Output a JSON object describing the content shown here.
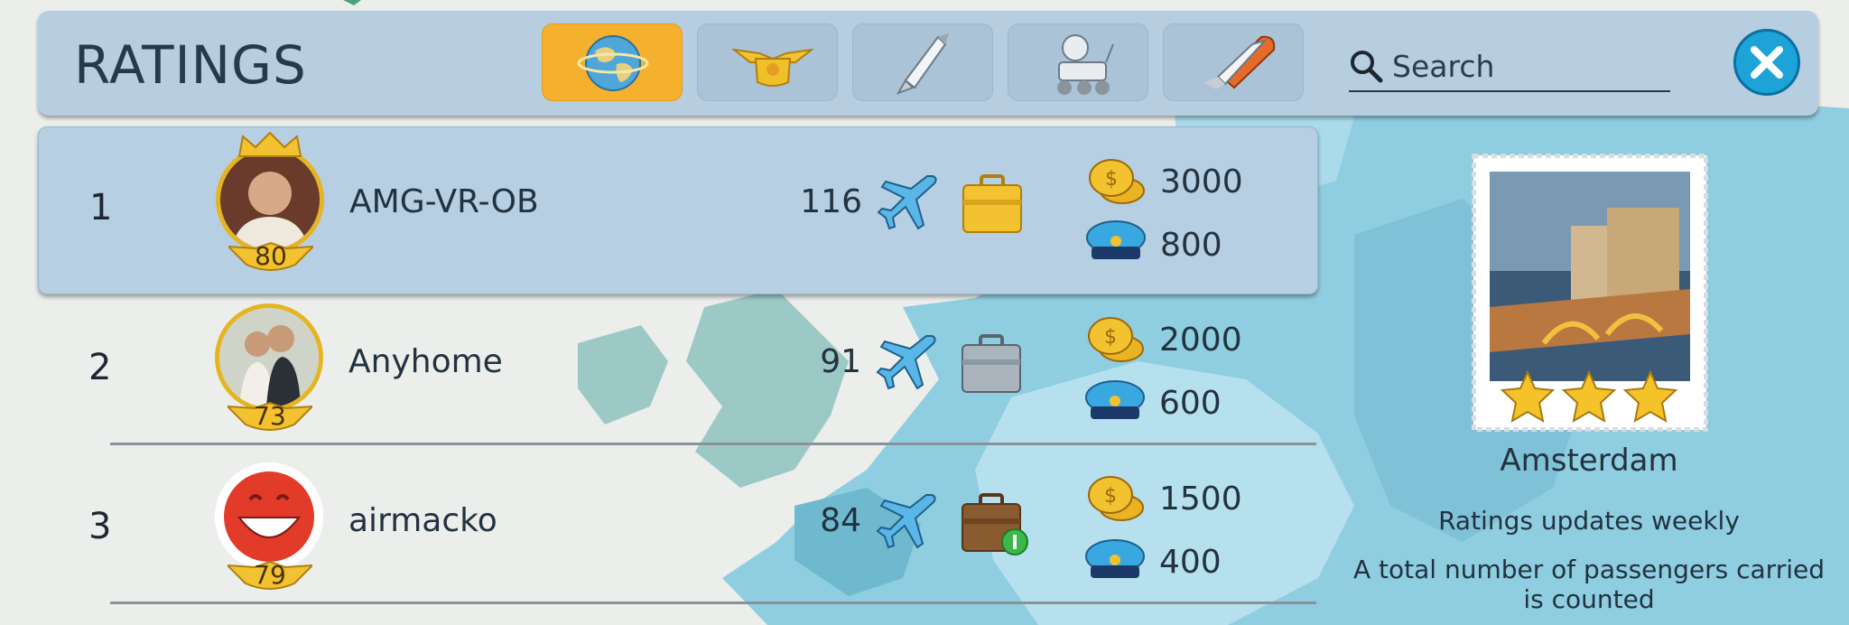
{
  "header": {
    "title": "RATINGS",
    "tabs": [
      {
        "icon": "globe-icon",
        "active": true
      },
      {
        "icon": "captain-cap-icon",
        "active": false
      },
      {
        "icon": "rocket-icon",
        "active": false
      },
      {
        "icon": "lunar-rover-icon",
        "active": false
      },
      {
        "icon": "space-shuttle-icon",
        "active": false
      }
    ],
    "search_placeholder": "Search",
    "close_icon": "close-icon"
  },
  "rows": [
    {
      "rank": "1",
      "name": "AMG-VR-OB",
      "level": "80",
      "planes": "116",
      "coins": "3000",
      "caps": "800",
      "case": "gold-briefcase-icon"
    },
    {
      "rank": "2",
      "name": "Anyhome",
      "level": "73",
      "planes": "91",
      "coins": "2000",
      "caps": "600",
      "case": "silver-briefcase-icon"
    },
    {
      "rank": "3",
      "name": "airmacko",
      "level": "79",
      "planes": "84",
      "coins": "1500",
      "caps": "400",
      "case": "brown-briefcase-icon"
    }
  ],
  "panel": {
    "city": "Amsterdam",
    "stars": 3,
    "note1": "Ratings updates weekly",
    "note2": "A total number of passengers carried is counted"
  },
  "colors": {
    "bar": "#b6cee0",
    "active_tab": "#f5b12e",
    "close": "#1ea3d8",
    "map_sea": "#8fcde0"
  }
}
